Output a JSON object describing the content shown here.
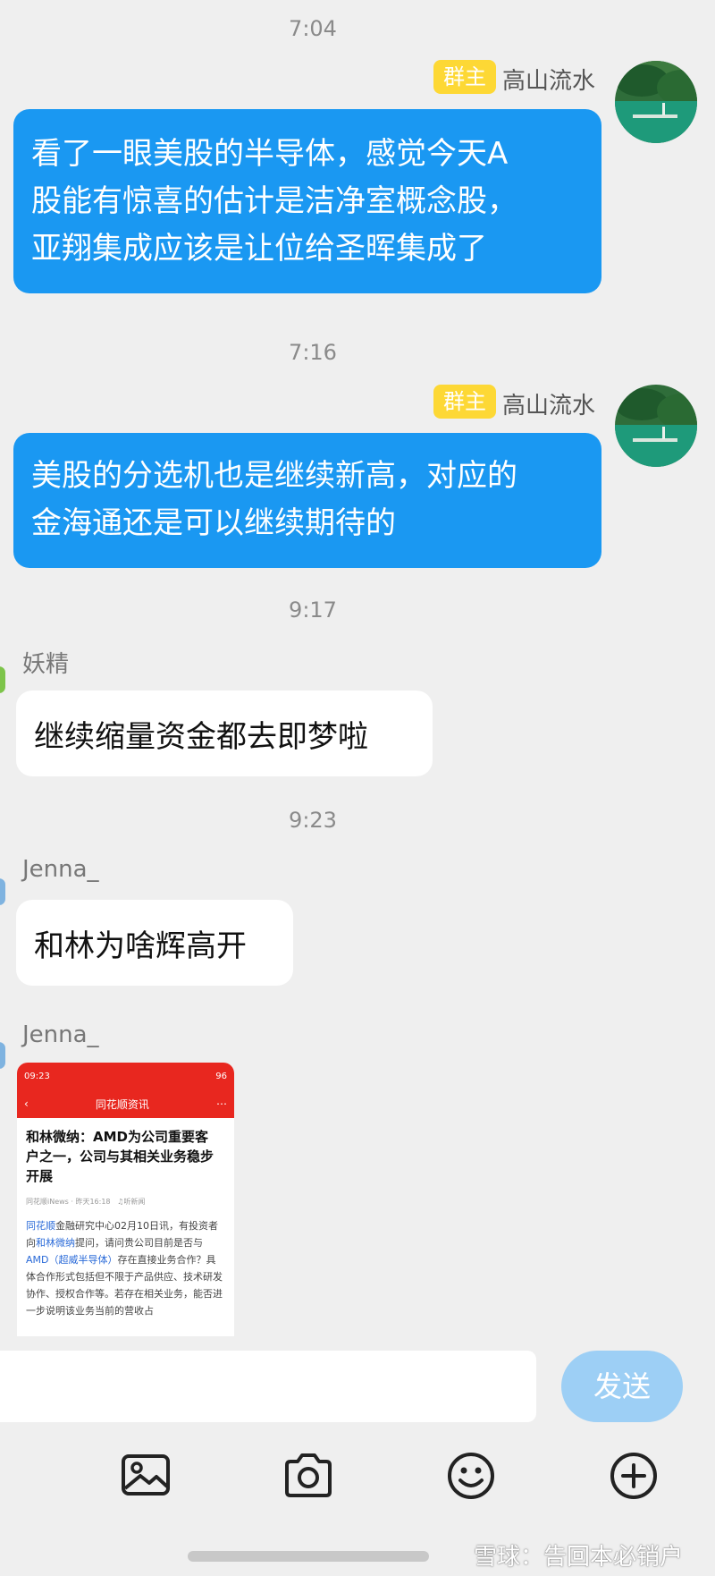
{
  "messages": {
    "m1": {
      "time": "7:04",
      "badge": "群主",
      "sender": "高山流水",
      "lines": [
        "看了一眼美股的半导体，感觉今天A",
        "股能有惊喜的估计是洁净室概念股，",
        "亚翔集成应该是让位给圣晖集成了"
      ]
    },
    "m2": {
      "time": "7:16",
      "badge": "群主",
      "sender": "高山流水",
      "lines": [
        "美股的分选机也是继续新高，对应的",
        "金海通还是可以继续期待的"
      ]
    },
    "m3": {
      "time": "9:17",
      "sender": "妖精",
      "text": "继续缩量资金都去即梦啦"
    },
    "m4": {
      "time": "9:23",
      "sender": "Jenna_",
      "text": "和林为啥辉高开"
    },
    "m5": {
      "sender": "Jenna_",
      "card": {
        "status_time": "09:23",
        "status_right": "96",
        "nav_title": "同花顺资讯",
        "title_lines": [
          "和林微纳：AMD为公司重要客",
          "户之一，公司与其相关业务稳步",
          "开展"
        ],
        "meta": "同花顺iNews · 昨天16:18",
        "meta_listen": "听新闻",
        "body": {
          "hl1": "同花顺",
          "t1": "金融研究中心02月10日讯，有投资者向",
          "hl2": "和林微纳",
          "t2": "提问，请问贵公司目前是否与 ",
          "hl3": "AMD（超威半导体）",
          "t3": "存在直接业务合作？具体合作形式包括但不限于产品供应、技术研发协作、授权合作等。若存在相关业务，能否进一步说明该业务当前的营收占"
        }
      }
    }
  },
  "input": {
    "placeholder": "",
    "send_label": "发送"
  },
  "toolbar": {
    "icons": [
      "image-icon",
      "camera-icon",
      "emoji-icon",
      "plus-icon"
    ]
  },
  "watermark": "雪球：告回本必销户",
  "colors": {
    "bubble_blue": "#1a98f2",
    "badge_yellow": "#fdd835",
    "send_button": "#9dcff5",
    "news_red": "#e8271f"
  }
}
